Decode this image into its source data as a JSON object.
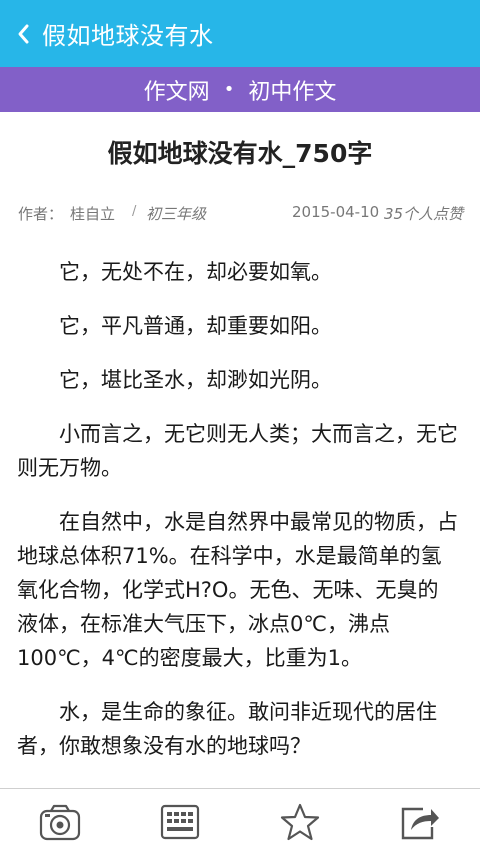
{
  "header": {
    "back_icon": "chevron-left-icon",
    "title": "假如地球没有水"
  },
  "section": {
    "site": "作文网",
    "separator": "•",
    "category": "初中作文"
  },
  "article": {
    "title": "假如地球没有水_750字",
    "meta": {
      "author_label": "作者：",
      "author_name": "桂自立",
      "divider": "/",
      "grade": "初三年级",
      "date": "2015-04-10",
      "likes": "35个人点赞"
    },
    "paragraphs": [
      "它，无处不在，却必要如氧。",
      "它，平凡普通，却重要如阳。",
      "它，堪比圣水，却渺如光阴。",
      "小而言之，无它则无人类；大而言之，无它则无万物。",
      "在自然中，水是自然界中最常见的物质，占地球总体积71%。在科学中，水是最简单的氢氧化合物，化学式H?O。无色、无味、无臭的液体，在标准大气压下，冰点0℃，沸点100℃，4℃的密度最大，比重为1。",
      "水，是生命的象征。敢问非近现代的居住者，你敢想象没有水的地球吗？"
    ]
  },
  "toolbar": {
    "icons": [
      "camera-icon",
      "keyboard-icon",
      "star-icon",
      "share-icon"
    ]
  },
  "colors": {
    "header_bg": "#27b6e8",
    "section_bg": "#8260c8"
  }
}
